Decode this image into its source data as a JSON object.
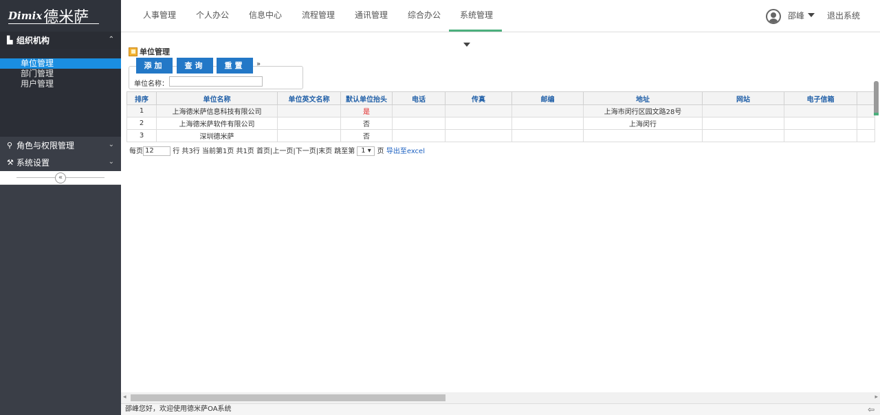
{
  "logo": {
    "latin": "Dimix",
    "cn": "德米萨"
  },
  "sidebar": {
    "groups": [
      {
        "label": "组织机构",
        "icon": "sitemap-icon",
        "chevron": "⌃"
      },
      {
        "label": "角色与权限管理",
        "icon": "pin-icon",
        "chevron": "⌄"
      },
      {
        "label": "系统设置",
        "icon": "wrench-icon",
        "chevron": "⌄"
      }
    ],
    "items": [
      {
        "label": "单位管理",
        "selected": true
      },
      {
        "label": "部门管理",
        "selected": false
      },
      {
        "label": "用户管理",
        "selected": false
      }
    ],
    "collapse_glyph": "«"
  },
  "topnav": {
    "items": [
      "人事管理",
      "个人办公",
      "信息中心",
      "流程管理",
      "通讯管理",
      "综合办公",
      "系统管理"
    ],
    "active": "系统管理",
    "user": "邵峰",
    "logout": "退出系统"
  },
  "page": {
    "title": "单位管理",
    "buttons": {
      "add": "添加",
      "query": "查询",
      "reset": "重置"
    },
    "toggle_glyph": "»",
    "search_label": "单位名称：",
    "search_value": ""
  },
  "table": {
    "headers": [
      "排序",
      "单位名称",
      "单位英文名称",
      "默认单位抬头",
      "电话",
      "传真",
      "邮编",
      "地址",
      "网站",
      "电子信箱"
    ],
    "rows": [
      [
        "1",
        "上海德米萨信息科技有限公司",
        "",
        "是",
        "",
        "",
        "",
        "上海市闵行区园文路28号",
        "",
        ""
      ],
      [
        "2",
        "上海德米萨软件有限公司",
        "",
        "否",
        "",
        "",
        "",
        "上海闵行",
        "",
        ""
      ],
      [
        "3",
        "深圳德米萨",
        "",
        "否",
        "",
        "",
        "",
        "",
        "",
        ""
      ]
    ]
  },
  "pager": {
    "per_page_label": "每页",
    "per_page_value": "12",
    "rows_text": "行 共3行  当前第1页  共1页  首页|上一页|下一页|末页  跳至第",
    "page_select": "1 ▾",
    "page_suffix": "页",
    "export": "导出至excel"
  },
  "status": {
    "text": "邵峰您好，欢迎使用德米萨OA系统"
  },
  "colors": {
    "accent_green": "#4caf7d",
    "button_blue": "#2378c7",
    "sidebar_bg": "#3a3e47",
    "selected_blue": "#1a8ee1"
  }
}
